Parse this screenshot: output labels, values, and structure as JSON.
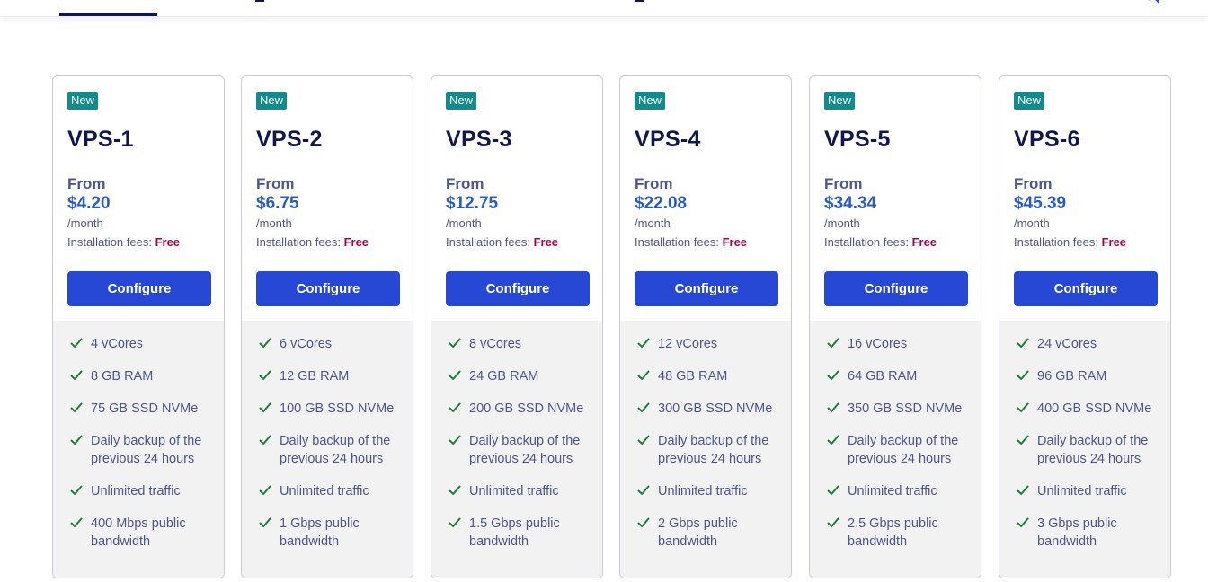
{
  "header": {
    "search_icon": "search-icon"
  },
  "plans": [
    {
      "badge": "New",
      "name": "VPS-1",
      "from_label": "From",
      "price": "$4.20",
      "period": "/month",
      "install_label": "Installation fees: ",
      "install_value": "Free",
      "configure_label": "Configure",
      "features": [
        "4 vCores",
        "8 GB RAM",
        "75 GB SSD NVMe",
        "Daily backup of the previous 24 hours",
        "Unlimited traffic",
        "400 Mbps public bandwidth"
      ]
    },
    {
      "badge": "New",
      "name": "VPS-2",
      "from_label": "From",
      "price": "$6.75",
      "period": "/month",
      "install_label": "Installation fees: ",
      "install_value": "Free",
      "configure_label": "Configure",
      "features": [
        "6 vCores",
        "12 GB RAM",
        "100 GB SSD NVMe",
        "Daily backup of the previous 24 hours",
        "Unlimited traffic",
        "1 Gbps public bandwidth"
      ]
    },
    {
      "badge": "New",
      "name": "VPS-3",
      "from_label": "From",
      "price": "$12.75",
      "period": "/month",
      "install_label": "Installation fees: ",
      "install_value": "Free",
      "configure_label": "Configure",
      "features": [
        "8 vCores",
        "24 GB RAM",
        "200 GB SSD NVMe",
        "Daily backup of the previous 24 hours",
        "Unlimited traffic",
        "1.5 Gbps public bandwidth"
      ]
    },
    {
      "badge": "New",
      "name": "VPS-4",
      "from_label": "From",
      "price": "$22.08",
      "period": "/month",
      "install_label": "Installation fees: ",
      "install_value": "Free",
      "configure_label": "Configure",
      "features": [
        "12 vCores",
        "48 GB RAM",
        "300 GB SSD NVMe",
        "Daily backup of the previous 24 hours",
        "Unlimited traffic",
        "2 Gbps public bandwidth"
      ]
    },
    {
      "badge": "New",
      "name": "VPS-5",
      "from_label": "From",
      "price": "$34.34",
      "period": "/month",
      "install_label": "Installation fees: ",
      "install_value": "Free",
      "configure_label": "Configure",
      "features": [
        "16 vCores",
        "64 GB RAM",
        "350 GB SSD NVMe",
        "Daily backup of the previous 24 hours",
        "Unlimited traffic",
        "2.5 Gbps public bandwidth"
      ]
    },
    {
      "badge": "New",
      "name": "VPS-6",
      "from_label": "From",
      "price": "$45.39",
      "period": "/month",
      "install_label": "Installation fees: ",
      "install_value": "Free",
      "configure_label": "Configure",
      "features": [
        "24 vCores",
        "96 GB RAM",
        "400 GB SSD NVMe",
        "Daily backup of the previous 24 hours",
        "Unlimited traffic",
        "3 Gbps public bandwidth"
      ]
    }
  ],
  "colors": {
    "badge": "#128b8c",
    "title": "#10174d",
    "price": "#2859c5",
    "free": "#a2044c",
    "button": "#2648d5",
    "check": "#1e7d3c",
    "features_bg": "#f2f2f2"
  },
  "icons": {
    "check": "check-icon"
  }
}
